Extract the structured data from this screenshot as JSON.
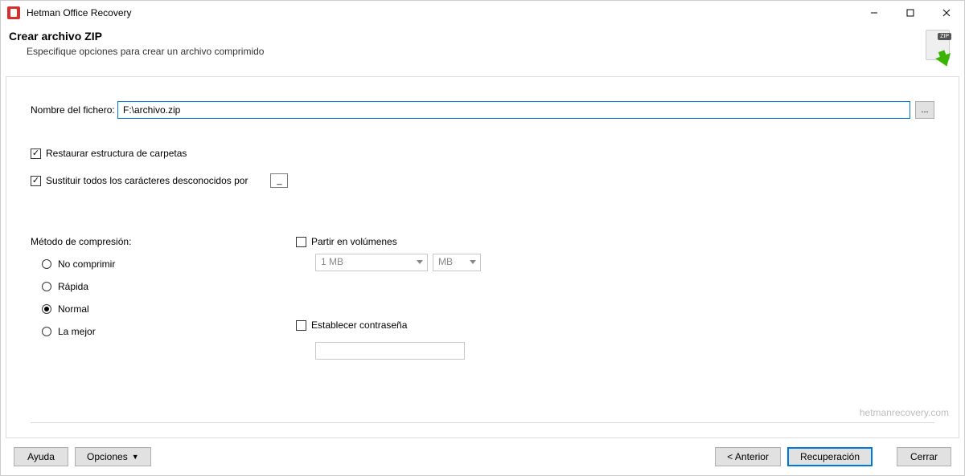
{
  "window": {
    "title": "Hetman Office Recovery"
  },
  "header": {
    "title": "Crear archivo ZIP",
    "subtitle": "Especifique opciones para crear un archivo comprimido",
    "icon_badge": "ZIP"
  },
  "filename": {
    "label": "Nombre del fichero:",
    "value": "F:\\archivo.zip",
    "browse": "..."
  },
  "options": {
    "restore_structure": {
      "label": "Restaurar estructura de carpetas",
      "checked": true
    },
    "substitute_unknown": {
      "label": "Sustituir todos los carácteres desconocidos por",
      "checked": true,
      "char": "_"
    }
  },
  "compression": {
    "label": "Método de compresión:",
    "choices": {
      "none": "No comprimir",
      "fast": "Rápida",
      "normal": "Normal",
      "best": "La mejor"
    },
    "selected": "normal"
  },
  "volumes": {
    "label": "Partir en volúmenes",
    "checked": false,
    "size_value": "1 MB",
    "unit_value": "MB"
  },
  "password": {
    "label": "Establecer contraseña",
    "checked": false,
    "value": ""
  },
  "branding": "hetmanrecovery.com",
  "footer": {
    "help": "Ayuda",
    "options": "Opciones",
    "back": "< Anterior",
    "recover": "Recuperación",
    "close": "Cerrar"
  }
}
